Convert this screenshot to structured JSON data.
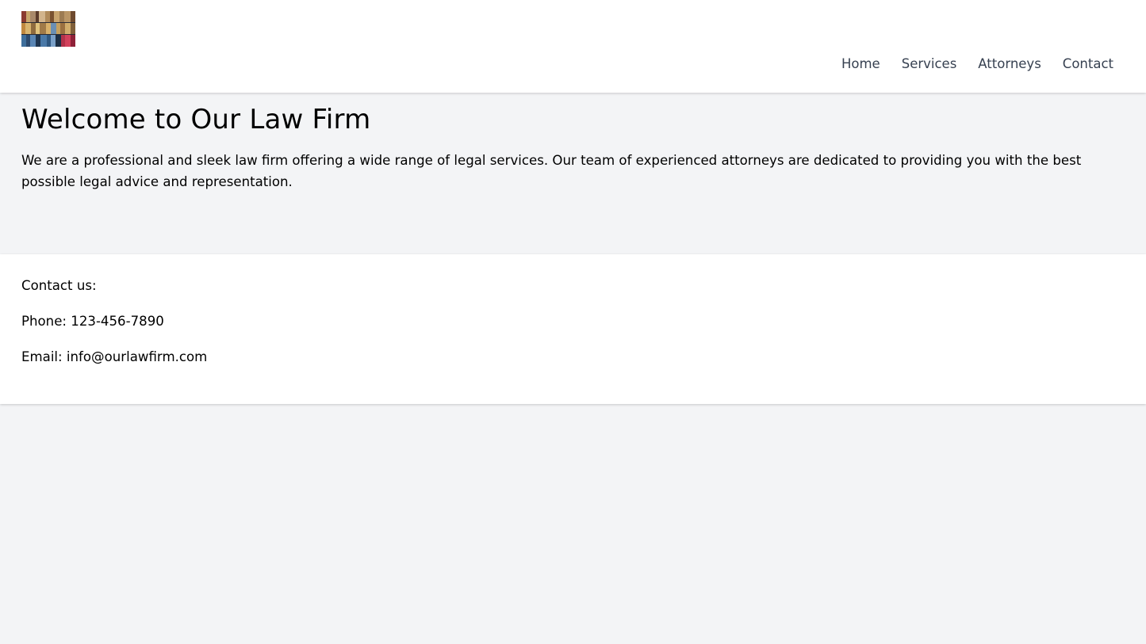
{
  "header": {
    "logo_alt": "law-books-logo",
    "nav": [
      {
        "label": "Home"
      },
      {
        "label": "Services"
      },
      {
        "label": "Attorneys"
      },
      {
        "label": "Contact"
      }
    ]
  },
  "main": {
    "title": "Welcome to Our Law Firm",
    "intro": "We are a professional and sleek law firm offering a wide range of legal services. Our team of experienced attorneys are dedicated to providing you with the best possible legal advice and representation."
  },
  "footer": {
    "contact_heading": "Contact us:",
    "phone": "Phone: 123-456-7890",
    "email": "Email: info@ourlawfirm.com"
  },
  "colors": {
    "background": "#f3f4f6",
    "surface": "#ffffff",
    "nav_text": "#374151",
    "text": "#000000"
  }
}
